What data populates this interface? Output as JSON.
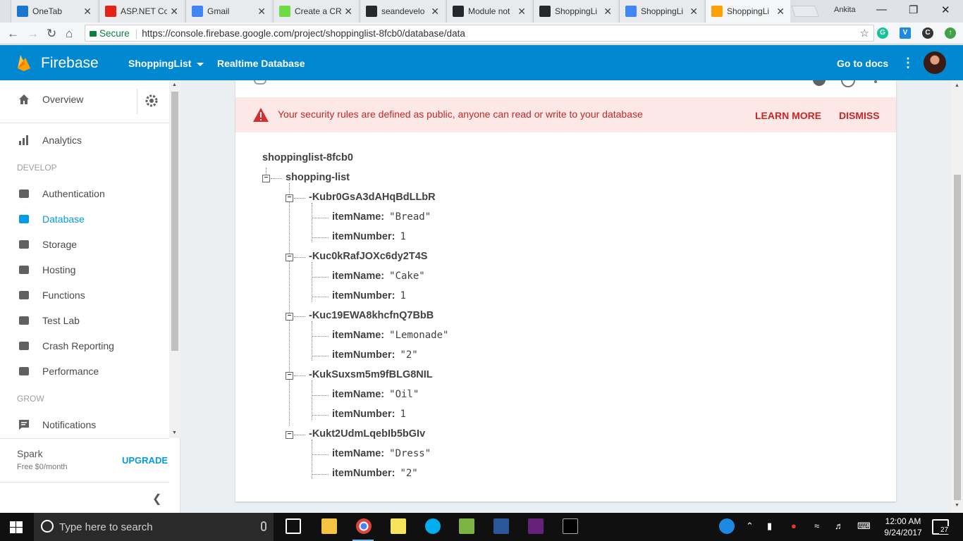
{
  "browser": {
    "tabs": [
      {
        "title": "OneTab",
        "icon": "onetab-icon",
        "color": "#1976d2"
      },
      {
        "title": "ASP.NET Co",
        "icon": "youtube-icon",
        "color": "#e62117"
      },
      {
        "title": "Gmail",
        "icon": "google-icon",
        "color": "#4285f4"
      },
      {
        "title": "Create a CR",
        "icon": "upwork-icon",
        "color": "#6fda44"
      },
      {
        "title": "seandevelo",
        "icon": "github-icon",
        "color": "#24292e"
      },
      {
        "title": "Module not",
        "icon": "github-icon",
        "color": "#24292e"
      },
      {
        "title": "ShoppingLi",
        "icon": "github-icon",
        "color": "#24292e"
      },
      {
        "title": "ShoppingLi",
        "icon": "chrome-page-icon",
        "color": "#4285f4"
      },
      {
        "title": "ShoppingLi",
        "icon": "firebase-icon",
        "color": "#ffa000"
      }
    ],
    "profile_name": "Ankita",
    "secure_label": "Secure",
    "url": "https://console.firebase.google.com/project/shoppinglist-8fcb0/database/data"
  },
  "header": {
    "brand": "Firebase",
    "project": "ShoppingList",
    "section": "Realtime Database",
    "docs_link": "Go to docs"
  },
  "sidebar": {
    "overview": "Overview",
    "analytics": "Analytics",
    "develop_header": "DEVELOP",
    "develop_items": [
      "Authentication",
      "Database",
      "Storage",
      "Hosting",
      "Functions",
      "Test Lab",
      "Crash Reporting",
      "Performance"
    ],
    "grow_header": "GROW",
    "notifications": "Notifications",
    "plan_name": "Spark",
    "plan_price": "Free $0/month",
    "upgrade": "UPGRADE"
  },
  "banner": {
    "message": "Your security rules are defined as public, anyone can read or write to your database",
    "learn_more": "LEARN MORE",
    "dismiss": "DISMISS"
  },
  "database": {
    "root": "shoppinglist-8fcb0",
    "list_key": "shopping-list",
    "entries": [
      {
        "key": "-Kubr0GsA3dAHqBdLLbR",
        "itemName": "\"Bread\"",
        "itemNumber": "1"
      },
      {
        "key": "-Kuc0kRafJOXc6dy2T4S",
        "itemName": "\"Cake\"",
        "itemNumber": "1"
      },
      {
        "key": "-Kuc19EWA8khcfnQ7BbB",
        "itemName": "\"Lemonade\"",
        "itemNumber": "\"2\""
      },
      {
        "key": "-KukSuxsm5m9fBLG8NIL",
        "itemName": "\"Oil\"",
        "itemNumber": "1"
      },
      {
        "key": "-Kukt2UdmLqebIb5bGIv",
        "itemName": "\"Dress\"",
        "itemNumber": "\"2\""
      }
    ],
    "field_name_label": "itemName:",
    "field_number_label": "itemNumber:"
  },
  "taskbar": {
    "search_placeholder": "Type here to search",
    "time": "12:00 AM",
    "date": "9/24/2017",
    "notification_count": "27"
  }
}
